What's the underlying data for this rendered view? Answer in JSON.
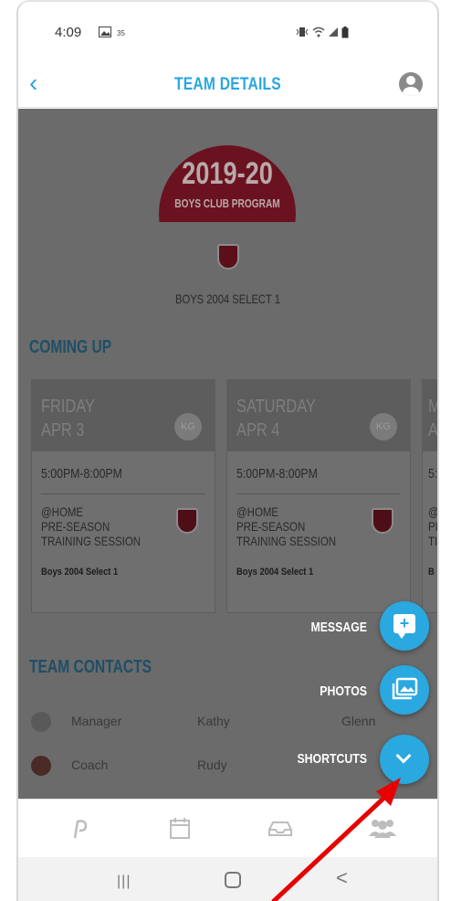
{
  "status_bar": {
    "time": "4:09",
    "icons": [
      "gallery-icon",
      "notification-count-icon",
      "vibrate-icon",
      "wifi-icon",
      "signal-icon",
      "battery-icon"
    ],
    "badge": "35"
  },
  "header": {
    "back_icon": "chevron-left-icon",
    "title": "TEAM DETAILS",
    "profile_icon": "user-profile-icon"
  },
  "team": {
    "logo_year": "2019-20",
    "logo_subtitle": "BOYS CLUB PROGRAM",
    "name": "BOYS 2004 SELECT 1"
  },
  "coming_up": {
    "heading": "COMING UP",
    "events": [
      {
        "day": "FRIDAY",
        "date": "APR 3",
        "badge": "KG",
        "time": "5:00PM-8:00PM",
        "description": "@HOME\nPRE-SEASON\nTRAINING SESSION",
        "team": "Boys 2004 Select 1"
      },
      {
        "day": "SATURDAY",
        "date": "APR 4",
        "badge": "KG",
        "time": "5:00PM-8:00PM",
        "description": "@HOME\nPRE-SEASON\nTRAINING SESSION",
        "team": "Boys 2004 Select 1"
      },
      {
        "day": "M",
        "date": "A",
        "badge": "",
        "time": "5:",
        "description": "@\nPI\nTI",
        "team": "B"
      }
    ]
  },
  "contacts": {
    "heading": "TEAM CONTACTS",
    "rows": [
      {
        "role": "Manager",
        "first": "Kathy",
        "last": "Glenn"
      },
      {
        "role": "Coach",
        "first": "Rudy",
        "last": ""
      }
    ]
  },
  "fab_menu": {
    "message_label": "MESSAGE",
    "photos_label": "PHOTOS",
    "shortcuts_label": "SHORTCUTS",
    "accent_color": "#2aa8e0"
  },
  "tab_bar": {
    "tabs": [
      "home-logo-icon",
      "calendar-icon",
      "inbox-icon",
      "team-icon"
    ]
  },
  "system_nav": {
    "recent_label": "|||",
    "back_label": "<"
  }
}
